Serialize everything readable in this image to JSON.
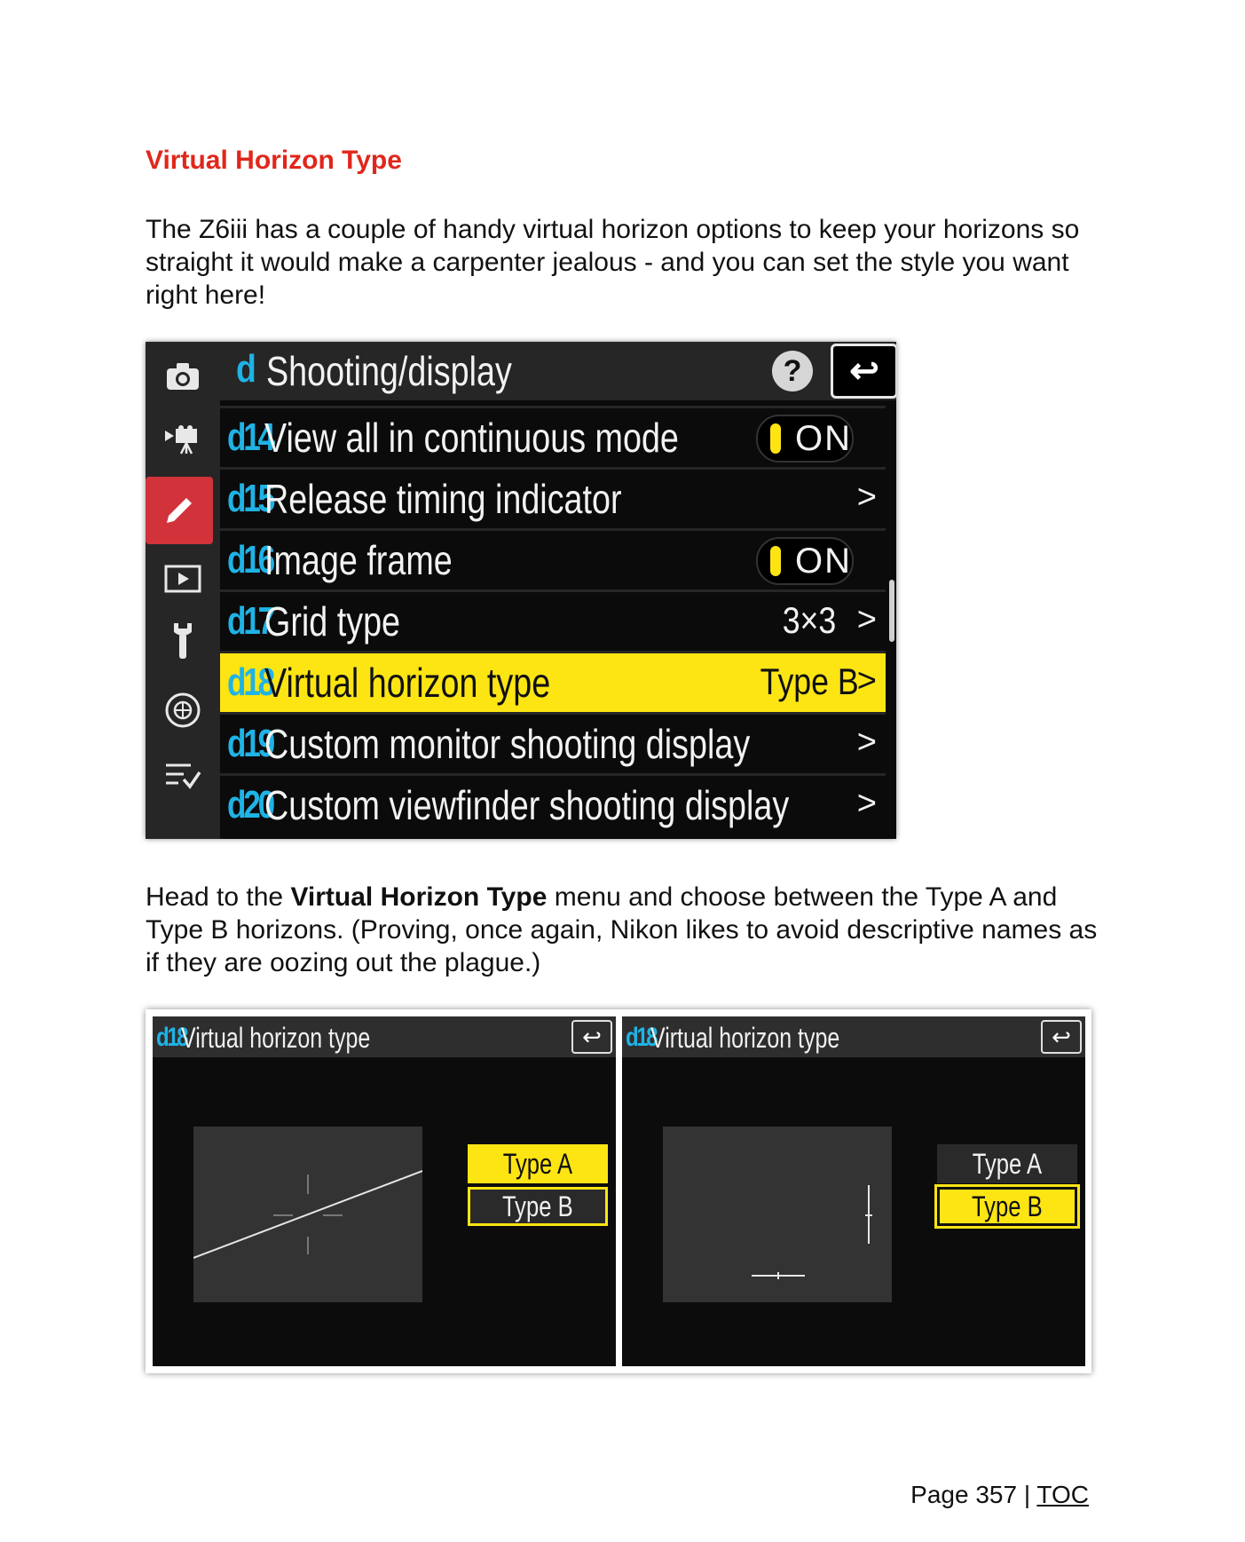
{
  "heading": "Virtual Horizon Type",
  "intro": "The Z6iii has a couple of handy virtual horizon options to keep your horizons so straight it would make a carpenter jealous - and you can set the style you want right here!",
  "camera_menu": {
    "header_letter": "d",
    "header_title": "Shooting/display",
    "help_glyph": "?",
    "back_glyph": "↩",
    "sidebar_icons": [
      "camera-icon",
      "movie-icon",
      "pencil-icon",
      "playback-icon",
      "wrench-icon",
      "network-icon",
      "my-menu-icon"
    ],
    "rows": [
      {
        "code": "d14",
        "label": "View all in continuous mode",
        "toggle": "ON"
      },
      {
        "code": "d15",
        "label": "Release timing indicator",
        "arrow": ">"
      },
      {
        "code": "d16",
        "label": "Image frame",
        "toggle": "ON"
      },
      {
        "code": "d17",
        "label": "Grid type",
        "value": "3×3",
        "arrow": ">"
      },
      {
        "code": "d18",
        "label": "Virtual horizon type",
        "value": "Type  B",
        "arrow": ">",
        "selected": true
      },
      {
        "code": "d19",
        "label": "Custom monitor shooting display",
        "arrow": ">"
      },
      {
        "code": "d20",
        "label": "Custom viewfinder shooting display",
        "arrow": ">"
      }
    ]
  },
  "body2": {
    "before": "Head to the ",
    "bold": "Virtual Horizon Type",
    "after": " menu and choose between the Type A and Type B horizons. (Proving, once again, Nikon likes to avoid descriptive names as if they are oozing out the plague.)"
  },
  "panels": [
    {
      "code": "d18",
      "title": "Virtual horizon type",
      "back_glyph": "↩",
      "option_a": "Type A",
      "option_b": "Type B",
      "selected": "Type A"
    },
    {
      "code": "d18",
      "title": "Virtual horizon type",
      "back_glyph": "↩",
      "option_a": "Type A",
      "option_b": "Type B",
      "selected": "Type B"
    }
  ],
  "footer": {
    "page": "Page 357 | ",
    "toc": "TOC"
  },
  "colors": {
    "heading": "#e0271b",
    "highlight": "#fde513",
    "code": "#1fb3e6",
    "active_tab": "#d2333a"
  }
}
